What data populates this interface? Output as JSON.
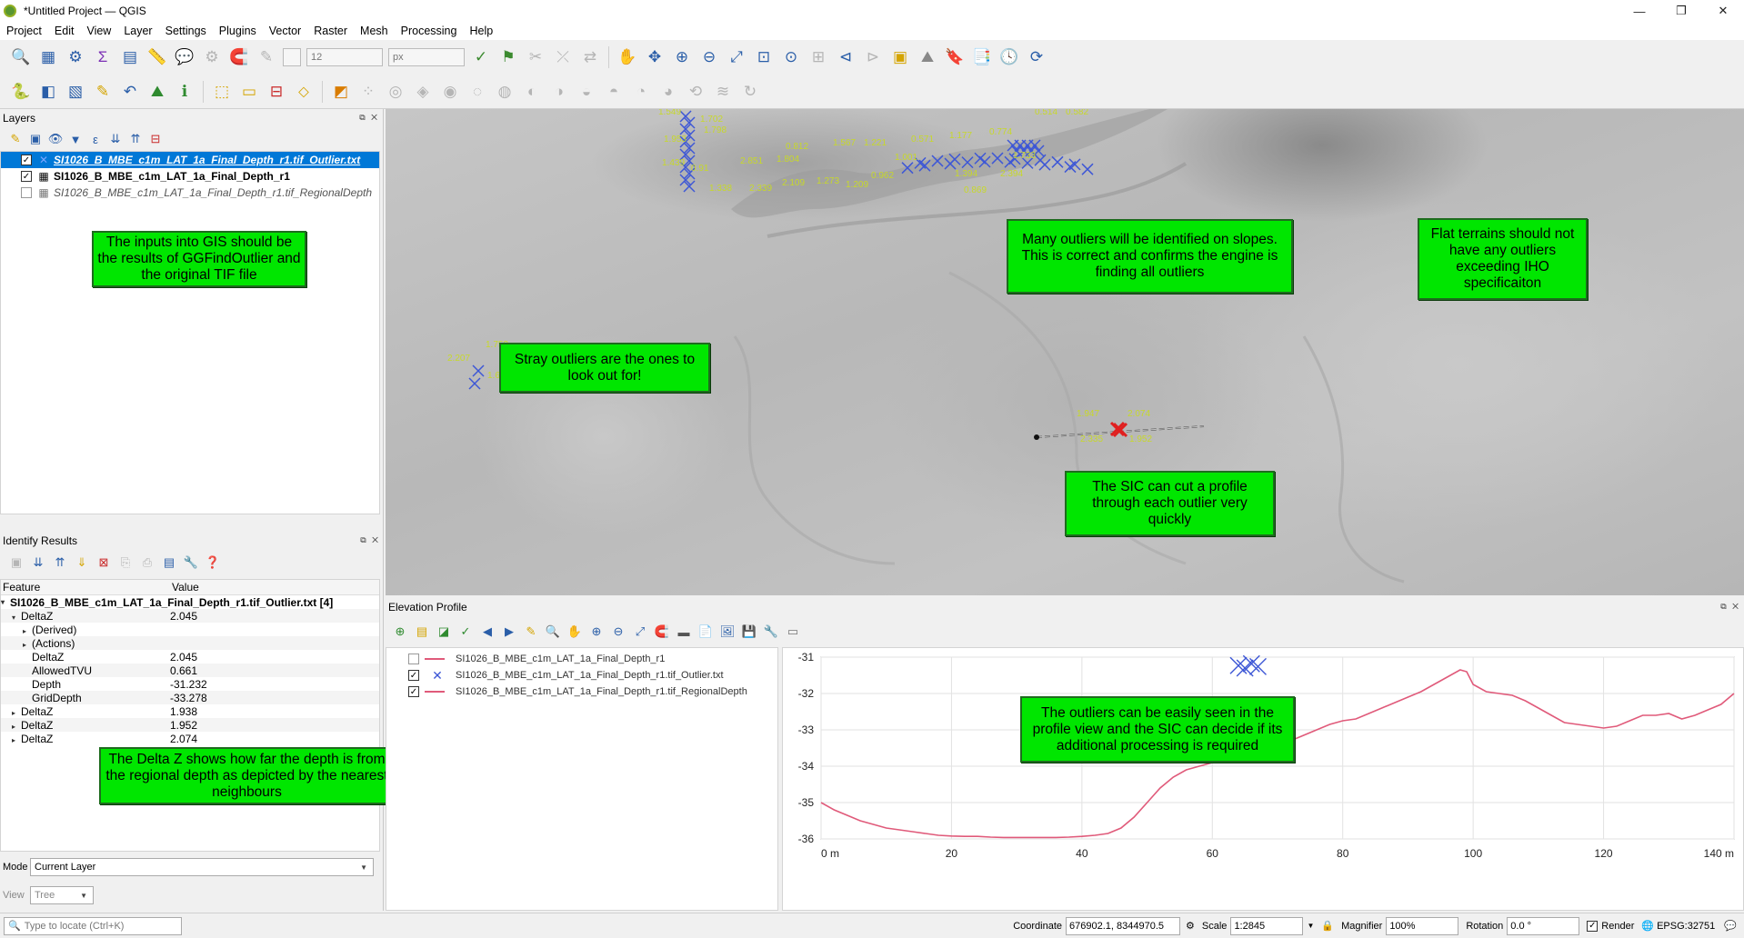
{
  "window": {
    "title": "*Untitled Project — QGIS",
    "minimize": "—",
    "maximize": "❐",
    "close": "✕"
  },
  "menu": [
    "Project",
    "Edit",
    "View",
    "Layer",
    "Settings",
    "Plugins",
    "Vector",
    "Raster",
    "Mesh",
    "Processing",
    "Help"
  ],
  "toolbar": {
    "size_value": "12",
    "unit_value": "px"
  },
  "layers_panel": {
    "title": "Layers",
    "items": [
      {
        "name": "SI1026_B_MBE_c1m_LAT_1a_Final_Depth_r1.tif_Outlier.txt",
        "checked": true
      },
      {
        "name": "SI1026_B_MBE_c1m_LAT_1a_Final_Depth_r1",
        "checked": true
      },
      {
        "name": "SI1026_B_MBE_c1m_LAT_1a_Final_Depth_r1.tif_RegionalDepth",
        "checked": false
      }
    ]
  },
  "notes": {
    "inputs": "The inputs into GIS should be the results of GGFindOutlier and the original TIF file",
    "deltaz": "The Delta Z shows how far the depth is from the regional depth as depicted by the nearest neighbours",
    "stray": "Stray outliers are the ones to look out for!",
    "slopes": "Many outliers will be identified on slopes. This is correct and confirms the engine is finding all outliers",
    "flat": "Flat terrains should not have any outliers exceeding IHO specificaiton",
    "sic": "The SIC can cut a profile through each outlier very quickly",
    "profile": "The outliers can be easily seen in the profile view and the SIC can decide if its additional processing is required"
  },
  "identify": {
    "title": "Identify Results",
    "col_feature": "Feature",
    "col_value": "Value",
    "layer_row": "SI1026_B_MBE_c1m_LAT_1a_Final_Depth_r1.tif_Outlier.txt  [4]",
    "rows": [
      {
        "f": "DeltaZ",
        "v": "2.045",
        "indent": 1,
        "tri": "▾"
      },
      {
        "f": "(Derived)",
        "v": "",
        "indent": 2,
        "tri": "▸"
      },
      {
        "f": "(Actions)",
        "v": "",
        "indent": 2,
        "tri": "▸"
      },
      {
        "f": "DeltaZ",
        "v": "2.045",
        "indent": 2,
        "tri": ""
      },
      {
        "f": "AllowedTVU",
        "v": "0.661",
        "indent": 2,
        "tri": ""
      },
      {
        "f": "Depth",
        "v": "-31.232",
        "indent": 2,
        "tri": ""
      },
      {
        "f": "GridDepth",
        "v": "-33.278",
        "indent": 2,
        "tri": ""
      },
      {
        "f": "DeltaZ",
        "v": "1.938",
        "indent": 1,
        "tri": "▸"
      },
      {
        "f": "DeltaZ",
        "v": "1.952",
        "indent": 1,
        "tri": "▸"
      },
      {
        "f": "DeltaZ",
        "v": "2.074",
        "indent": 1,
        "tri": "▸"
      }
    ],
    "mode_label": "Mode",
    "mode_value": "Current Layer",
    "view_label": "View",
    "view_value": "Tree"
  },
  "map_labels": {
    "top": [
      "1.549",
      "1.702",
      "1.953",
      "1.798",
      "1.439",
      "0.91",
      "1.338",
      "2.851",
      "2.339",
      "1.804",
      "2.109",
      "0.812",
      "1.273",
      "1.567",
      "1.209",
      "1.221",
      "0.962",
      "1.001",
      "0.571",
      "1.177",
      "1.394",
      "0.869",
      "0.774",
      "2.394",
      "1.733",
      "0.514",
      "0.582"
    ],
    "stray": [
      "2.207",
      "1.753",
      "1.644"
    ],
    "sic": [
      "1.947",
      "2.074",
      "2.335",
      "1.952"
    ]
  },
  "elevation": {
    "title": "Elevation Profile",
    "layers": [
      {
        "name": "SI1026_B_MBE_c1m_LAT_1a_Final_Depth_r1",
        "checked": false,
        "sym": "line"
      },
      {
        "name": "SI1026_B_MBE_c1m_LAT_1a_Final_Depth_r1.tif_Outlier.txt",
        "checked": true,
        "sym": "cross"
      },
      {
        "name": "SI1026_B_MBE_c1m_LAT_1a_Final_Depth_r1.tif_RegionalDepth",
        "checked": true,
        "sym": "line"
      }
    ],
    "line_color": "#e05a7a",
    "cross_color": "#3d57d6"
  },
  "chart_data": {
    "type": "line",
    "xlim": [
      0,
      140
    ],
    "ylim": [
      -36,
      -31
    ],
    "x_ticks": [
      "0 m",
      "20",
      "40",
      "60",
      "80",
      "100",
      "120",
      "140 m"
    ],
    "y_ticks": [
      "-31",
      "-32",
      "-33",
      "-34",
      "-35",
      "-36"
    ],
    "grid": true,
    "series": [
      {
        "x": [
          0,
          2,
          4,
          6,
          8,
          10,
          12,
          14,
          16,
          18,
          20,
          22,
          24,
          26,
          28,
          30,
          32,
          34,
          36,
          38,
          40,
          42,
          44,
          46,
          48,
          50,
          52,
          54,
          56,
          58,
          60,
          62,
          64,
          66,
          68,
          70,
          72,
          74,
          76,
          78,
          80,
          82,
          84,
          86,
          88,
          90,
          92,
          94,
          96,
          98,
          99,
          100,
          102,
          104,
          106,
          108,
          110,
          112,
          114,
          116,
          118,
          120,
          122,
          124,
          126,
          128,
          130,
          132,
          134,
          136,
          138,
          140
        ],
        "y": [
          -35.0,
          -35.2,
          -35.35,
          -35.5,
          -35.6,
          -35.7,
          -35.75,
          -35.8,
          -35.85,
          -35.9,
          -35.92,
          -35.93,
          -35.93,
          -35.95,
          -35.96,
          -35.96,
          -35.96,
          -35.96,
          -35.96,
          -35.95,
          -35.93,
          -35.9,
          -35.85,
          -35.7,
          -35.4,
          -35.0,
          -34.6,
          -34.3,
          -34.1,
          -34.0,
          -33.9,
          -33.85,
          -33.75,
          -33.65,
          -33.55,
          -33.45,
          -33.3,
          -33.15,
          -33.0,
          -32.85,
          -32.75,
          -32.7,
          -32.55,
          -32.4,
          -32.25,
          -32.1,
          -31.95,
          -31.75,
          -31.55,
          -31.35,
          -31.4,
          -31.75,
          -31.95,
          -32.0,
          -32.05,
          -32.2,
          -32.4,
          -32.6,
          -32.8,
          -32.85,
          -32.9,
          -32.95,
          -32.9,
          -32.75,
          -32.6,
          -32.6,
          -32.55,
          -32.7,
          -32.6,
          -32.45,
          -32.3,
          -32.0
        ]
      }
    ],
    "outliers": [
      {
        "x": 64,
        "y": -31.232
      },
      {
        "x": 65,
        "y": -31.3
      },
      {
        "x": 66,
        "y": -31.18
      },
      {
        "x": 67,
        "y": -31.26
      }
    ]
  },
  "statusbar": {
    "locate_placeholder": "Type to locate (Ctrl+K)",
    "coord_label": "Coordinate",
    "coord_value": "676902.1, 8344970.5",
    "scale_label": "Scale",
    "scale_value": "1:2845",
    "magnifier_label": "Magnifier",
    "magnifier_value": "100%",
    "rotation_label": "Rotation",
    "rotation_value": "0.0 °",
    "render_label": "Render",
    "crs": "EPSG:32751"
  }
}
